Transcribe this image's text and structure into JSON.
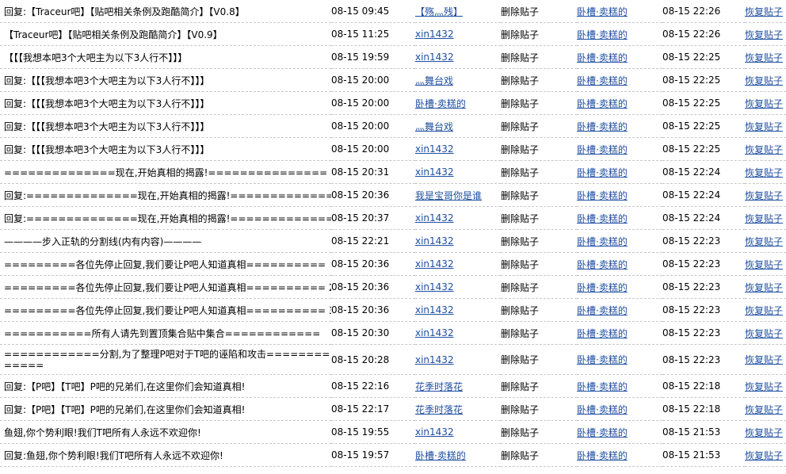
{
  "rows": [
    {
      "title": "回复:【Traceur吧】【贴吧相关条例及跑酷简介】【V0.8】",
      "post_time": "08-15 09:45",
      "author": "【殇灬残】",
      "action": "删除贴子",
      "operator": "卧槽·卖糕的",
      "op_time": "08-15 22:26",
      "restore": "恢复贴子"
    },
    {
      "title": "【Traceur吧】【贴吧相关条例及跑酷简介】【V0.9】",
      "post_time": "08-15 11:25",
      "author": "xin1432",
      "action": "删除贴子",
      "operator": "卧槽·卖糕的",
      "op_time": "08-15 22:26",
      "restore": "恢复贴子"
    },
    {
      "title": "【【【我想本吧3个大吧主为以下3人行不】】】",
      "post_time": "08-15 19:59",
      "author": "xin1432",
      "action": "删除贴子",
      "operator": "卧槽·卖糕的",
      "op_time": "08-15 22:25",
      "restore": "恢复贴子"
    },
    {
      "title": "回复:【【【我想本吧3个大吧主为以下3人行不】】】",
      "post_time": "08-15 20:00",
      "author": "灬舞台戏",
      "action": "删除贴子",
      "operator": "卧槽·卖糕的",
      "op_time": "08-15 22:25",
      "restore": "恢复贴子"
    },
    {
      "title": "回复:【【【我想本吧3个大吧主为以下3人行不】】】",
      "post_time": "08-15 20:00",
      "author": "卧槽·卖糕的",
      "action": "删除贴子",
      "operator": "卧槽·卖糕的",
      "op_time": "08-15 22:25",
      "restore": "恢复贴子"
    },
    {
      "title": "回复:【【【我想本吧3个大吧主为以下3人行不】】】",
      "post_time": "08-15 20:00",
      "author": "灬舞台戏",
      "action": "删除贴子",
      "operator": "卧槽·卖糕的",
      "op_time": "08-15 22:25",
      "restore": "恢复贴子"
    },
    {
      "title": "回复:【【【我想本吧3个大吧主为以下3人行不】】】",
      "post_time": "08-15 20:00",
      "author": "xin1432",
      "action": "删除贴子",
      "operator": "卧槽·卖糕的",
      "op_time": "08-15 22:25",
      "restore": "恢复贴子"
    },
    {
      "title": "==============现在,开始真相的揭露!===============",
      "post_time": "08-15 20:31",
      "author": "xin1432",
      "action": "删除贴子",
      "operator": "卧槽·卖糕的",
      "op_time": "08-15 22:24",
      "restore": "恢复贴子"
    },
    {
      "title": "回复:==============现在,开始真相的揭露!===============",
      "post_time": "08-15 20:36",
      "author": "我是宝哥你是谁",
      "action": "删除贴子",
      "operator": "卧槽·卖糕的",
      "op_time": "08-15 22:24",
      "restore": "恢复贴子"
    },
    {
      "title": "回复:==============现在,开始真相的揭露!===============",
      "post_time": "08-15 20:37",
      "author": "xin1432",
      "action": "删除贴子",
      "operator": "卧槽·卖糕的",
      "op_time": "08-15 22:24",
      "restore": "恢复贴子"
    },
    {
      "title": "————步入正轨的分割线(内有内容)————",
      "post_time": "08-15 22:21",
      "author": "xin1432",
      "action": "删除贴子",
      "operator": "卧槽·卖糕的",
      "op_time": "08-15 22:23",
      "restore": "恢复贴子"
    },
    {
      "title": "=========各位先停止回复,我们要让P吧人知道真相==========",
      "post_time": "08-15 20:36",
      "author": "xin1432",
      "action": "删除贴子",
      "operator": "卧槽·卖糕的",
      "op_time": "08-15 22:23",
      "restore": "恢复贴子"
    },
    {
      "title": "=========各位先停止回复,我们要让P吧人知道真相========== 2",
      "post_time": "08-15 20:36",
      "author": "xin1432",
      "action": "删除贴子",
      "operator": "卧槽·卖糕的",
      "op_time": "08-15 22:23",
      "restore": "恢复贴子"
    },
    {
      "title": "=========各位先停止回复,我们要让P吧人知道真相========== 3",
      "post_time": "08-15 20:36",
      "author": "xin1432",
      "action": "删除贴子",
      "operator": "卧槽·卖糕的",
      "op_time": "08-15 22:23",
      "restore": "恢复贴子"
    },
    {
      "title": "===========所有人请先到置顶集合贴中集合============",
      "post_time": "08-15 20:30",
      "author": "xin1432",
      "action": "删除贴子",
      "operator": "卧槽·卖糕的",
      "op_time": "08-15 22:23",
      "restore": "恢复贴子"
    },
    {
      "title": "============分割,为了整理P吧对于T吧的诬陷和攻击=============",
      "post_time": "08-15 20:28",
      "author": "xin1432",
      "action": "删除贴子",
      "operator": "卧槽·卖糕的",
      "op_time": "08-15 22:23",
      "restore": "恢复贴子"
    },
    {
      "title": "回复:【P吧】【T吧】P吧的兄弟们,在这里你们会知道真相!",
      "post_time": "08-15 22:16",
      "author": "花季时落花",
      "action": "删除贴子",
      "operator": "卧槽·卖糕的",
      "op_time": "08-15 22:18",
      "restore": "恢复贴子"
    },
    {
      "title": "回复:【P吧】【T吧】P吧的兄弟们,在这里你们会知道真相!",
      "post_time": "08-15 22:17",
      "author": "花季时落花",
      "action": "删除贴子",
      "operator": "卧槽·卖糕的",
      "op_time": "08-15 22:18",
      "restore": "恢复贴子"
    },
    {
      "title": "鱼翅,你个势利眼!我们T吧所有人永远不欢迎你!",
      "post_time": "08-15 19:55",
      "author": "xin1432",
      "action": "删除贴子",
      "operator": "卧槽·卖糕的",
      "op_time": "08-15 21:53",
      "restore": "恢复贴子"
    },
    {
      "title": "回复:鱼翅,你个势利眼!我们T吧所有人永远不欢迎你!",
      "post_time": "08-15 19:57",
      "author": "卧槽·卖糕的",
      "action": "删除贴子",
      "operator": "卧槽·卖糕的",
      "op_time": "08-15 21:53",
      "restore": "恢复贴子"
    }
  ]
}
